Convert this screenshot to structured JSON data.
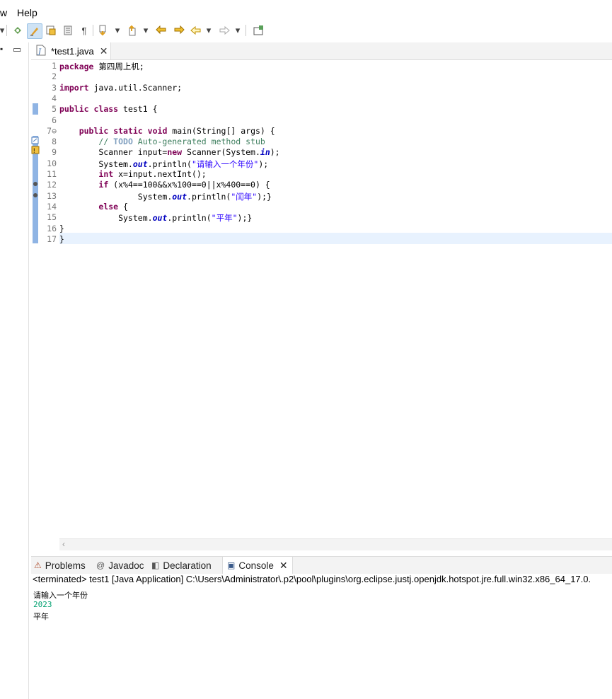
{
  "menubar": {
    "items": [
      "w",
      "Help"
    ]
  },
  "toolbar": {
    "dropdown_glyph": "▾"
  },
  "left_panel": {
    "restore_glyph": "▭"
  },
  "editor_tab": {
    "label": "*test1.java"
  },
  "code_lines": [
    {
      "n": "1",
      "segs": [
        {
          "t": "kw",
          "v": "package"
        },
        {
          "t": "",
          "v": " 第四周上机;"
        }
      ]
    },
    {
      "n": "2",
      "segs": []
    },
    {
      "n": "3",
      "segs": [
        {
          "t": "kw",
          "v": "import"
        },
        {
          "t": "",
          "v": " java.util.Scanner;"
        }
      ]
    },
    {
      "n": "4",
      "segs": []
    },
    {
      "n": "5",
      "segs": [
        {
          "t": "kw",
          "v": "public"
        },
        {
          "t": "",
          "v": " "
        },
        {
          "t": "kw",
          "v": "class"
        },
        {
          "t": "",
          "v": " test1 {"
        }
      ]
    },
    {
      "n": "6",
      "segs": []
    },
    {
      "n": "7⊖",
      "segs": [
        {
          "t": "",
          "v": "    "
        },
        {
          "t": "kw",
          "v": "public"
        },
        {
          "t": "",
          "v": " "
        },
        {
          "t": "kw",
          "v": "static"
        },
        {
          "t": "",
          "v": " "
        },
        {
          "t": "kw",
          "v": "void"
        },
        {
          "t": "",
          "v": " main(String[] args) {"
        }
      ]
    },
    {
      "n": "8",
      "segs": [
        {
          "t": "",
          "v": "        "
        },
        {
          "t": "cm",
          "v": "// "
        },
        {
          "t": "todo",
          "v": "TODO"
        },
        {
          "t": "cm",
          "v": " Auto-generated method stub"
        }
      ]
    },
    {
      "n": "9",
      "segs": [
        {
          "t": "",
          "v": "        Scanner input="
        },
        {
          "t": "kw",
          "v": "new"
        },
        {
          "t": "",
          "v": " Scanner(System."
        },
        {
          "t": "fi",
          "v": "in"
        },
        {
          "t": "",
          "v": ");"
        }
      ]
    },
    {
      "n": "10",
      "segs": [
        {
          "t": "",
          "v": "        System."
        },
        {
          "t": "fi",
          "v": "out"
        },
        {
          "t": "",
          "v": ".println("
        },
        {
          "t": "st",
          "v": "\"请输入一个年份\""
        },
        {
          "t": "",
          "v": ");"
        }
      ]
    },
    {
      "n": "11",
      "segs": [
        {
          "t": "",
          "v": "        "
        },
        {
          "t": "kw",
          "v": "int"
        },
        {
          "t": "",
          "v": " x=input.nextInt();"
        }
      ]
    },
    {
      "n": "12",
      "segs": [
        {
          "t": "",
          "v": "        "
        },
        {
          "t": "kw",
          "v": "if"
        },
        {
          "t": "",
          "v": " (x%4==100&&x%100==0||x%400==0) {"
        }
      ]
    },
    {
      "n": "13",
      "segs": [
        {
          "t": "",
          "v": "                System."
        },
        {
          "t": "fi",
          "v": "out"
        },
        {
          "t": "",
          "v": ".println("
        },
        {
          "t": "st",
          "v": "\"闰年\""
        },
        {
          "t": "",
          "v": ");}"
        }
      ]
    },
    {
      "n": "14",
      "segs": [
        {
          "t": "",
          "v": "        "
        },
        {
          "t": "kw",
          "v": "else"
        },
        {
          "t": "",
          "v": " {"
        }
      ]
    },
    {
      "n": "15",
      "segs": [
        {
          "t": "",
          "v": "            System."
        },
        {
          "t": "fi",
          "v": "out"
        },
        {
          "t": "",
          "v": ".println("
        },
        {
          "t": "st",
          "v": "\"平年\""
        },
        {
          "t": "",
          "v": ");}"
        }
      ]
    },
    {
      "n": "16",
      "segs": [
        {
          "t": "",
          "v": "}"
        }
      ]
    },
    {
      "n": "17",
      "segs": [
        {
          "t": "",
          "v": "}"
        }
      ]
    }
  ],
  "panel_tabs": [
    {
      "id": "problems",
      "icon": "problems-icon",
      "glyph": "⚠",
      "label": "Problems"
    },
    {
      "id": "javadoc",
      "icon": "at-icon",
      "glyph": "@",
      "label": "Javadoc"
    },
    {
      "id": "declaration",
      "icon": "declaration-icon",
      "glyph": "◧",
      "label": "Declaration"
    },
    {
      "id": "console",
      "icon": "console-icon",
      "glyph": "▣",
      "label": "Console"
    }
  ],
  "console": {
    "header": "<terminated> test1 [Java Application] C:\\Users\\Administrator\\.p2\\pool\\plugins\\org.eclipse.justj.openjdk.hotspot.jre.full.win32.x86_64_17.0.",
    "lines": [
      {
        "text": "请输入一个年份",
        "color": "#000000"
      },
      {
        "text": "2023",
        "color": "#00a070"
      },
      {
        "text": "平年",
        "color": "#000000"
      }
    ]
  },
  "colors": {
    "keyword": "#7f0055",
    "comment": "#3f7f5f",
    "string": "#2a00ff",
    "field": "#0000c0",
    "ruler": "#8fb4e4",
    "current_line": "#e8f2fe"
  }
}
